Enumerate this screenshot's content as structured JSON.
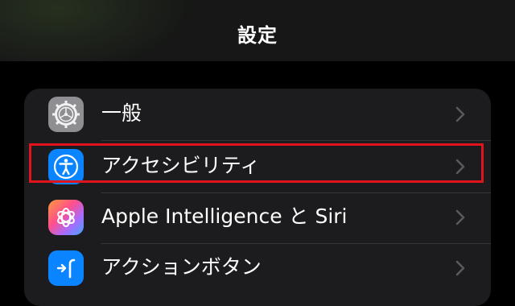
{
  "nav": {
    "title": "設定"
  },
  "rows": [
    {
      "label": "一般",
      "icon": "gear-icon",
      "color": "#8e8e93"
    },
    {
      "label": "アクセシビリティ",
      "icon": "accessibility-icon",
      "color": "#0a84ff"
    },
    {
      "label": "Apple Intelligence と Siri",
      "icon": "apple-intelligence-icon"
    },
    {
      "label": "アクションボタン",
      "icon": "action-button-icon",
      "color": "#0a84ff"
    }
  ],
  "highlight": {
    "color": "#e0141c",
    "row": "アクセシビリティ"
  }
}
